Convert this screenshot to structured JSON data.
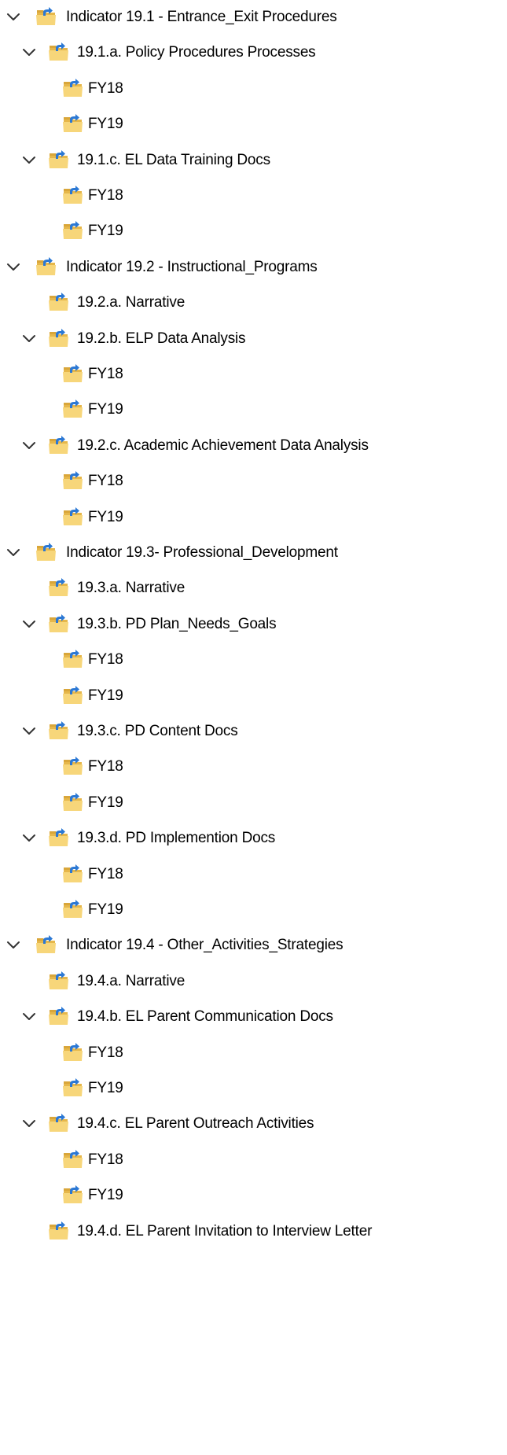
{
  "tree": {
    "items": [
      {
        "label": "Indicator 19.1 - Entrance_Exit Procedures",
        "level": 0,
        "expanded": true,
        "has_children": true
      },
      {
        "label": "19.1.a. Policy Procedures Processes",
        "level": 1,
        "expanded": true,
        "has_children": true
      },
      {
        "label": "FY18",
        "level": 2,
        "expanded": false,
        "has_children": false
      },
      {
        "label": "FY19",
        "level": 2,
        "expanded": false,
        "has_children": false
      },
      {
        "label": "19.1.c. EL Data Training Docs",
        "level": 1,
        "expanded": true,
        "has_children": true
      },
      {
        "label": "FY18",
        "level": 2,
        "expanded": false,
        "has_children": false
      },
      {
        "label": "FY19",
        "level": 2,
        "expanded": false,
        "has_children": false
      },
      {
        "label": "Indicator 19.2 - Instructional_Programs",
        "level": 0,
        "expanded": true,
        "has_children": true
      },
      {
        "label": "19.2.a. Narrative",
        "level": 1,
        "expanded": false,
        "has_children": false
      },
      {
        "label": "19.2.b. ELP Data Analysis",
        "level": 1,
        "expanded": true,
        "has_children": true
      },
      {
        "label": "FY18",
        "level": 2,
        "expanded": false,
        "has_children": false
      },
      {
        "label": "FY19",
        "level": 2,
        "expanded": false,
        "has_children": false
      },
      {
        "label": "19.2.c. Academic Achievement Data Analysis",
        "level": 1,
        "expanded": true,
        "has_children": true
      },
      {
        "label": "FY18",
        "level": 2,
        "expanded": false,
        "has_children": false
      },
      {
        "label": "FY19",
        "level": 2,
        "expanded": false,
        "has_children": false
      },
      {
        "label": "Indicator 19.3-  Professional_Development",
        "level": 0,
        "expanded": true,
        "has_children": true
      },
      {
        "label": "19.3.a. Narrative",
        "level": 1,
        "expanded": false,
        "has_children": false
      },
      {
        "label": "19.3.b. PD Plan_Needs_Goals",
        "level": 1,
        "expanded": true,
        "has_children": true
      },
      {
        "label": "FY18",
        "level": 2,
        "expanded": false,
        "has_children": false
      },
      {
        "label": "FY19",
        "level": 2,
        "expanded": false,
        "has_children": false
      },
      {
        "label": "19.3.c. PD Content Docs",
        "level": 1,
        "expanded": true,
        "has_children": true
      },
      {
        "label": "FY18",
        "level": 2,
        "expanded": false,
        "has_children": false
      },
      {
        "label": "FY19",
        "level": 2,
        "expanded": false,
        "has_children": false
      },
      {
        "label": "19.3.d. PD Implemention Docs",
        "level": 1,
        "expanded": true,
        "has_children": true
      },
      {
        "label": "FY18",
        "level": 2,
        "expanded": false,
        "has_children": false
      },
      {
        "label": "FY19",
        "level": 2,
        "expanded": false,
        "has_children": false
      },
      {
        "label": "Indicator 19.4 - Other_Activities_Strategies",
        "level": 0,
        "expanded": true,
        "has_children": true
      },
      {
        "label": "19.4.a. Narrative",
        "level": 1,
        "expanded": false,
        "has_children": false
      },
      {
        "label": "19.4.b. EL Parent Communication Docs",
        "level": 1,
        "expanded": true,
        "has_children": true
      },
      {
        "label": "FY18",
        "level": 2,
        "expanded": false,
        "has_children": false
      },
      {
        "label": "FY19",
        "level": 2,
        "expanded": false,
        "has_children": false
      },
      {
        "label": "19.4.c. EL Parent Outreach Activities",
        "level": 1,
        "expanded": true,
        "has_children": true
      },
      {
        "label": "FY18",
        "level": 2,
        "expanded": false,
        "has_children": false
      },
      {
        "label": "FY19",
        "level": 2,
        "expanded": false,
        "has_children": false
      },
      {
        "label": "19.4.d. EL Parent Invitation to Interview Letter",
        "level": 1,
        "expanded": false,
        "has_children": false
      }
    ]
  },
  "icons": {
    "expand": "chevron-down-icon",
    "folder": "shared-folder-icon"
  },
  "colors": {
    "folder_back": "#e6b74a",
    "folder_front": "#f7d67a",
    "folder_tab": "#d9a63a",
    "share_arrow": "#2b78d4",
    "chevron": "#333333",
    "text": "#000000",
    "background": "#ffffff"
  }
}
